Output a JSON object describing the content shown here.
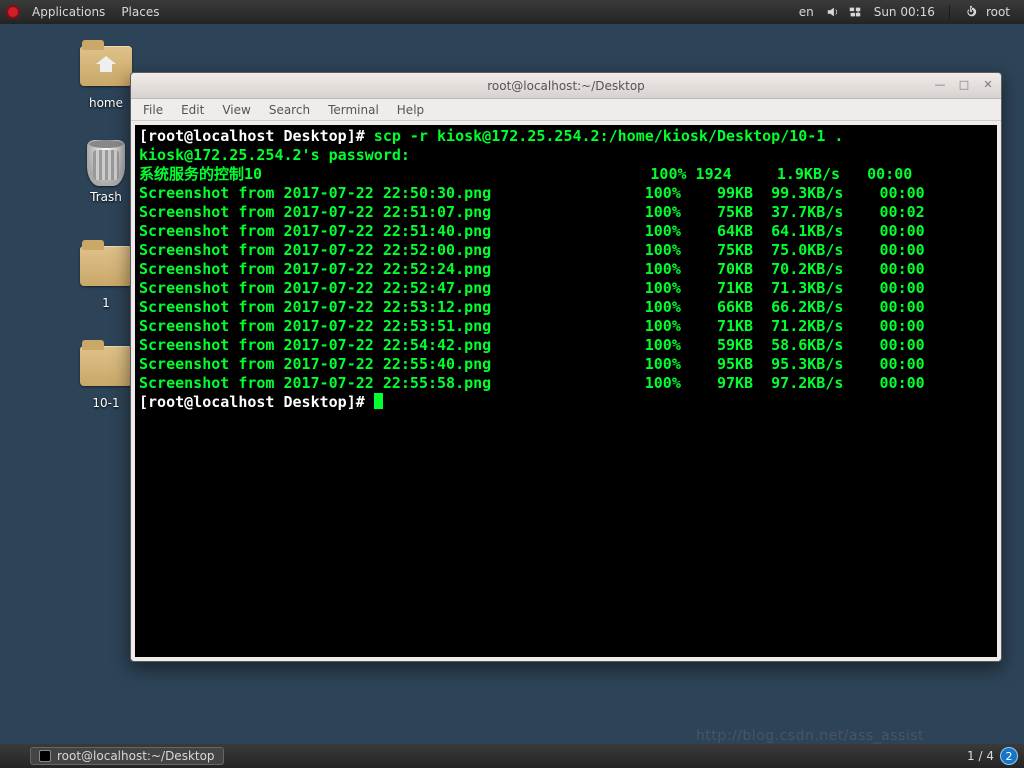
{
  "panel": {
    "applications": "Applications",
    "places": "Places",
    "lang": "en",
    "clock": "Sun 00:16",
    "user": "root"
  },
  "desktop": {
    "home": "home",
    "trash": "Trash",
    "f1": "1",
    "f2": "10-1"
  },
  "terminal": {
    "title": "root@localhost:~/Desktop",
    "menu": {
      "file": "File",
      "edit": "Edit",
      "view": "View",
      "search": "Search",
      "terminal": "Terminal",
      "help": "Help"
    },
    "prompt": "[root@localhost Desktop]#",
    "cmd": "scp -r kiosk@172.25.254.2:/home/kiosk/Desktop/10-1 .",
    "pwline": "kiosk@172.25.254.2's password:",
    "first": {
      "name": "系统服务的控制10",
      "pct": "100%",
      "size": "1924",
      "rate": "1.9KB/s",
      "eta": "00:00"
    },
    "rows": [
      {
        "name": "Screenshot from 2017-07-22 22:50:30.png",
        "pct": "100%",
        "size": "99KB",
        "rate": "99.3KB/s",
        "eta": "00:00"
      },
      {
        "name": "Screenshot from 2017-07-22 22:51:07.png",
        "pct": "100%",
        "size": "75KB",
        "rate": "37.7KB/s",
        "eta": "00:02"
      },
      {
        "name": "Screenshot from 2017-07-22 22:51:40.png",
        "pct": "100%",
        "size": "64KB",
        "rate": "64.1KB/s",
        "eta": "00:00"
      },
      {
        "name": "Screenshot from 2017-07-22 22:52:00.png",
        "pct": "100%",
        "size": "75KB",
        "rate": "75.0KB/s",
        "eta": "00:00"
      },
      {
        "name": "Screenshot from 2017-07-22 22:52:24.png",
        "pct": "100%",
        "size": "70KB",
        "rate": "70.2KB/s",
        "eta": "00:00"
      },
      {
        "name": "Screenshot from 2017-07-22 22:52:47.png",
        "pct": "100%",
        "size": "71KB",
        "rate": "71.3KB/s",
        "eta": "00:00"
      },
      {
        "name": "Screenshot from 2017-07-22 22:53:12.png",
        "pct": "100%",
        "size": "66KB",
        "rate": "66.2KB/s",
        "eta": "00:00"
      },
      {
        "name": "Screenshot from 2017-07-22 22:53:51.png",
        "pct": "100%",
        "size": "71KB",
        "rate": "71.2KB/s",
        "eta": "00:00"
      },
      {
        "name": "Screenshot from 2017-07-22 22:54:42.png",
        "pct": "100%",
        "size": "59KB",
        "rate": "58.6KB/s",
        "eta": "00:00"
      },
      {
        "name": "Screenshot from 2017-07-22 22:55:40.png",
        "pct": "100%",
        "size": "95KB",
        "rate": "95.3KB/s",
        "eta": "00:00"
      },
      {
        "name": "Screenshot from 2017-07-22 22:55:58.png",
        "pct": "100%",
        "size": "97KB",
        "rate": "97.2KB/s",
        "eta": "00:00"
      }
    ]
  },
  "bottom": {
    "task": "root@localhost:~/Desktop",
    "workspace": "1 / 4",
    "ws_num": "2"
  },
  "watermark": "http://blog.csdn.net/ass_assist"
}
